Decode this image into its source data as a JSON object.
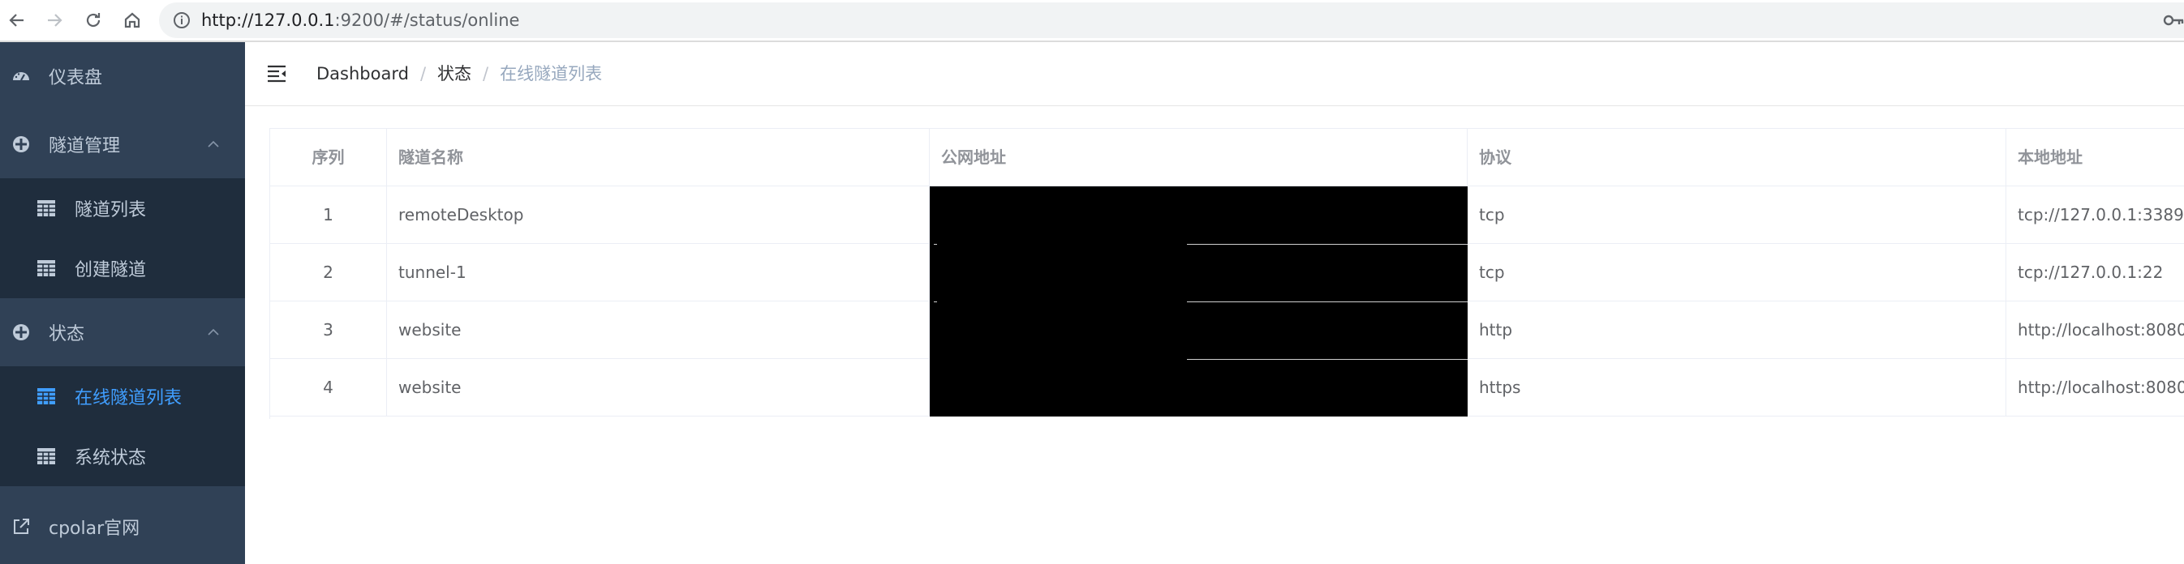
{
  "browser": {
    "url_host": "http://127.0.0.1",
    "url_rest": ":9200/#/status/online"
  },
  "sidebar": {
    "items": [
      {
        "label": "仪表盘",
        "icon": "dashboard-icon"
      },
      {
        "label": "隧道管理",
        "icon": "tunnel-manage-icon",
        "expanded": true,
        "children": [
          {
            "label": "隧道列表",
            "icon": "table-icon"
          },
          {
            "label": "创建隧道",
            "icon": "table-icon"
          }
        ]
      },
      {
        "label": "状态",
        "icon": "status-icon",
        "expanded": true,
        "children": [
          {
            "label": "在线隧道列表",
            "icon": "table-icon",
            "active": true
          },
          {
            "label": "系统状态",
            "icon": "table-icon"
          }
        ]
      },
      {
        "label": "cpolar官网",
        "icon": "external-link-icon"
      }
    ]
  },
  "breadcrumb": [
    "Dashboard",
    "状态",
    "在线隧道列表"
  ],
  "table": {
    "headers": [
      "序列",
      "隧道名称",
      "公网地址",
      "协议",
      "本地地址"
    ],
    "rows": [
      {
        "index": "1",
        "name": "remoteDesktop",
        "public_url": "",
        "protocol": "tcp",
        "local": "tcp://127.0.0.1:3389"
      },
      {
        "index": "2",
        "name": "tunnel-1",
        "public_url": "",
        "protocol": "tcp",
        "local": "tcp://127.0.0.1:22"
      },
      {
        "index": "3",
        "name": "website",
        "public_url": "",
        "protocol": "http",
        "local": "http://localhost:8080"
      },
      {
        "index": "4",
        "name": "website",
        "public_url": "",
        "protocol": "https",
        "local": "http://localhost:8080"
      }
    ]
  },
  "colors": {
    "sidebar_bg": "#304156",
    "submenu_bg": "#1f2d3d",
    "sidebar_text": "#bfcbd9",
    "active": "#409eff",
    "redaction": "#000000"
  }
}
